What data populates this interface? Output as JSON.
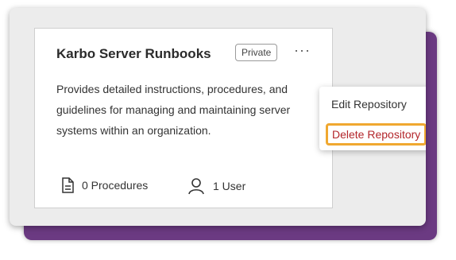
{
  "card": {
    "title": "Karbo Server Runbooks",
    "badge": "Private",
    "menu_icon": "more-horizontal-icon",
    "description": "Provides detailed instructions, procedures, and\nguidelines for managing and maintaining server\nsystems within an organization.",
    "procedures_icon": "document-icon",
    "procedures": "0 Procedures",
    "users_icon": "user-icon",
    "users": "1 User"
  },
  "menu": {
    "edit": "Edit Repository",
    "delete": "Delete Repository"
  },
  "colors": {
    "delete_text": "#b3262b",
    "highlight": "#f0a830",
    "frame_shadow": "#6b3a82"
  }
}
